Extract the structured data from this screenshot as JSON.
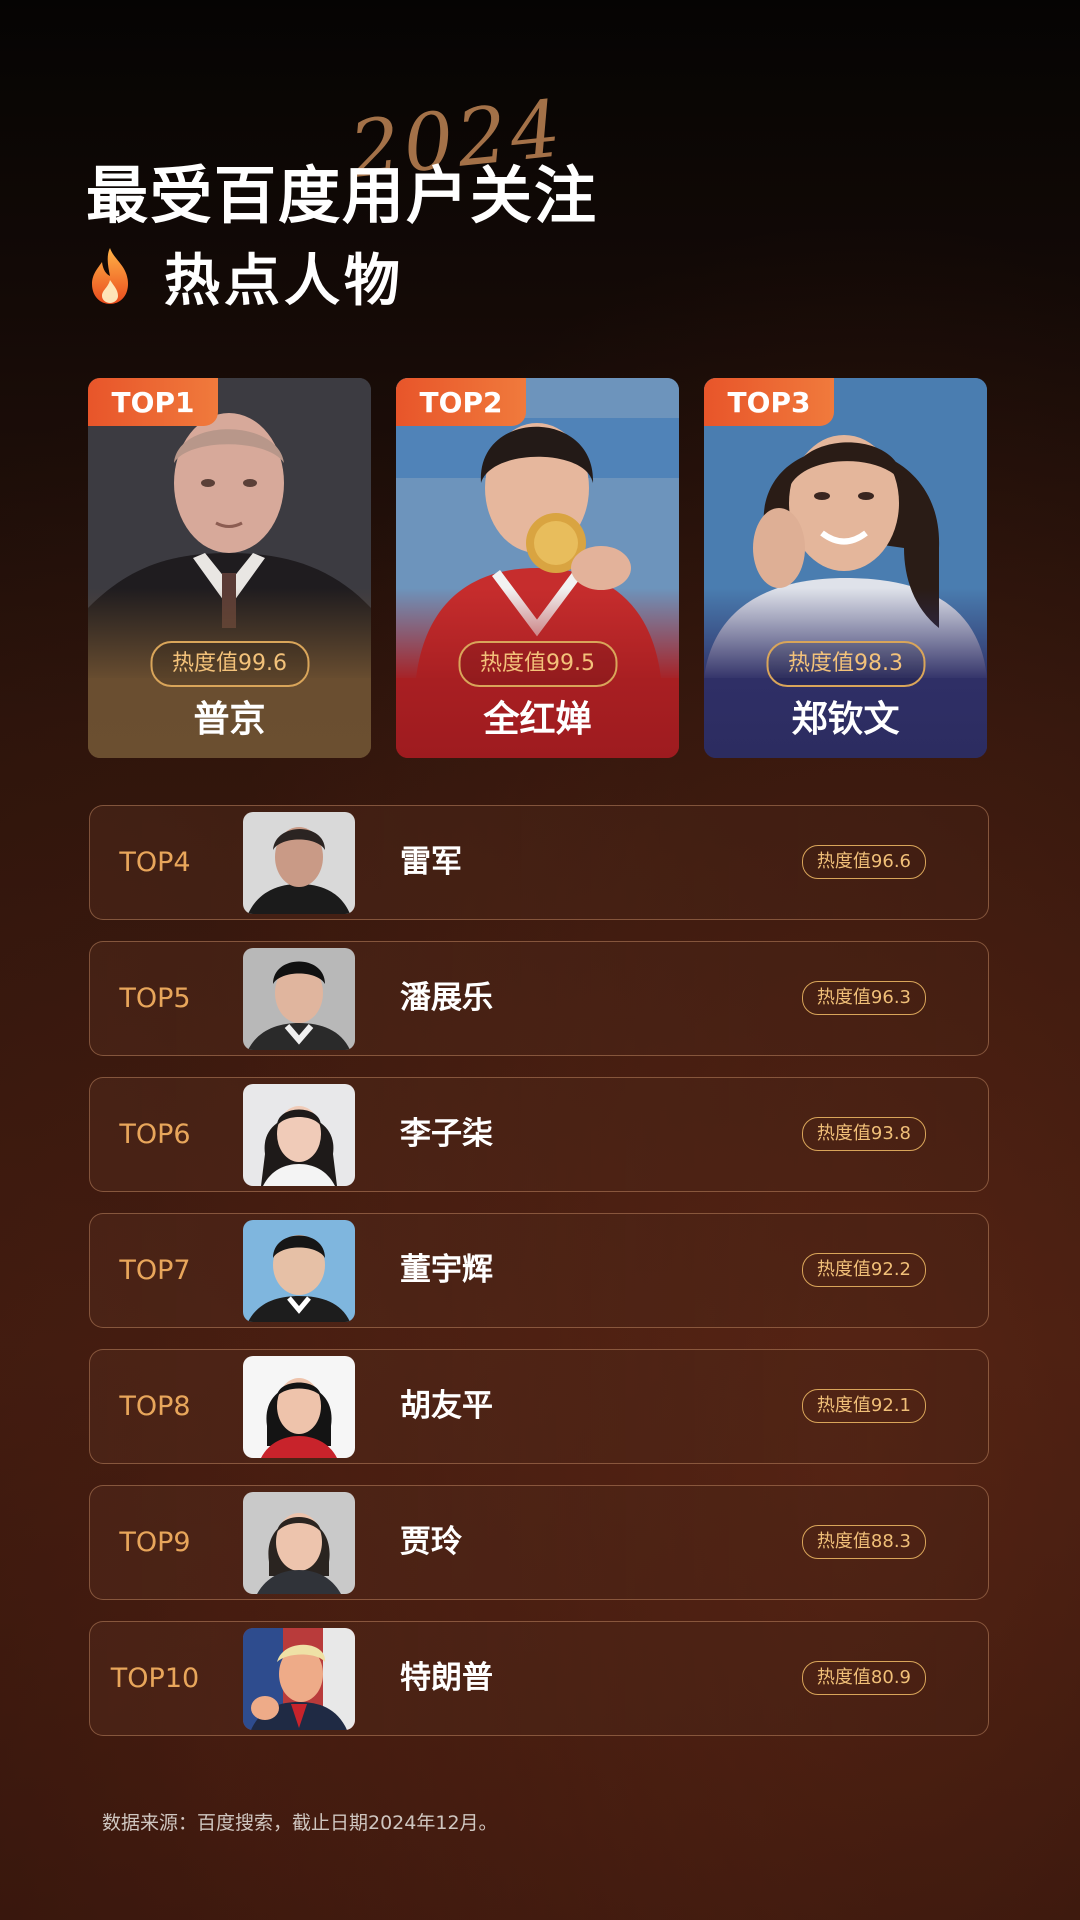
{
  "header": {
    "year_script": "2024",
    "title_line1": "最受百度用户关注",
    "title_line2": "热点人物"
  },
  "top3": [
    {
      "rank": "TOP1",
      "heat": "热度值99.6",
      "name": "普京"
    },
    {
      "rank": "TOP2",
      "heat": "热度值99.5",
      "name": "全红婵"
    },
    {
      "rank": "TOP3",
      "heat": "热度值98.3",
      "name": "郑钦文"
    }
  ],
  "list": [
    {
      "rank": "TOP4",
      "name": "雷军",
      "heat": "热度值96.6"
    },
    {
      "rank": "TOP5",
      "name": "潘展乐",
      "heat": "热度值96.3"
    },
    {
      "rank": "TOP6",
      "name": "李子柒",
      "heat": "热度值93.8"
    },
    {
      "rank": "TOP7",
      "name": "董宇辉",
      "heat": "热度值92.2"
    },
    {
      "rank": "TOP8",
      "name": "胡友平",
      "heat": "热度值92.1"
    },
    {
      "rank": "TOP9",
      "name": "贾玲",
      "heat": "热度值88.3"
    },
    {
      "rank": "TOP10",
      "name": "特朗普",
      "heat": "热度值80.9"
    }
  ],
  "footer": {
    "source": "数据来源：百度搜索，截止日期2024年12月。"
  },
  "colors": {
    "accent_orange": "#e8552a",
    "gold_text": "#e8a65b",
    "badge_border": "#d9a55a"
  },
  "icons": {
    "title_icon": "flame-icon"
  }
}
